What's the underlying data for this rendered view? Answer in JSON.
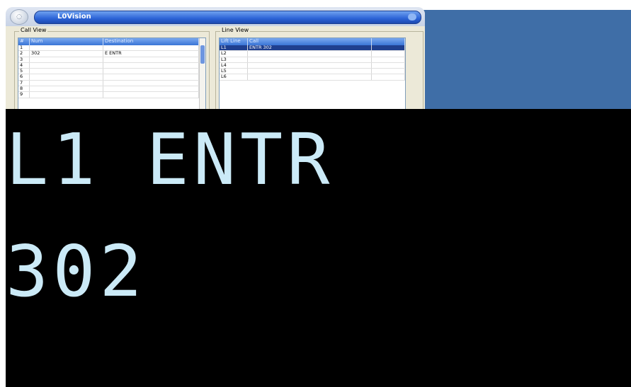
{
  "window": {
    "title": "L0Vision"
  },
  "call_view": {
    "legend": "Call View",
    "columns": [
      "#",
      "Num",
      "Destination"
    ],
    "rows": [
      [
        "1",
        "",
        ""
      ],
      [
        "2",
        "302",
        "E ENTR"
      ],
      [
        "3",
        "",
        ""
      ],
      [
        "4",
        "",
        ""
      ],
      [
        "5",
        "",
        ""
      ],
      [
        "6",
        "",
        ""
      ],
      [
        "7",
        "",
        ""
      ],
      [
        "8",
        "",
        ""
      ],
      [
        "9",
        "",
        ""
      ]
    ]
  },
  "line_view": {
    "legend": "Line View",
    "columns": [
      "Lift Line",
      "Call",
      ""
    ],
    "rows": [
      [
        "L1",
        "ENTR 302",
        ""
      ],
      [
        "L2",
        "",
        ""
      ],
      [
        "L3",
        "",
        ""
      ],
      [
        "L4",
        "",
        ""
      ],
      [
        "L5",
        "",
        ""
      ],
      [
        "L6",
        "",
        ""
      ]
    ],
    "selected_row": 0
  },
  "display": {
    "line1": "L1 ENTR",
    "line2": "302",
    "text_color": "#cbeaf7",
    "background": "#000000"
  },
  "colors": {
    "desktop": "#3f6ea7",
    "title_bar": "#2c63d6"
  }
}
